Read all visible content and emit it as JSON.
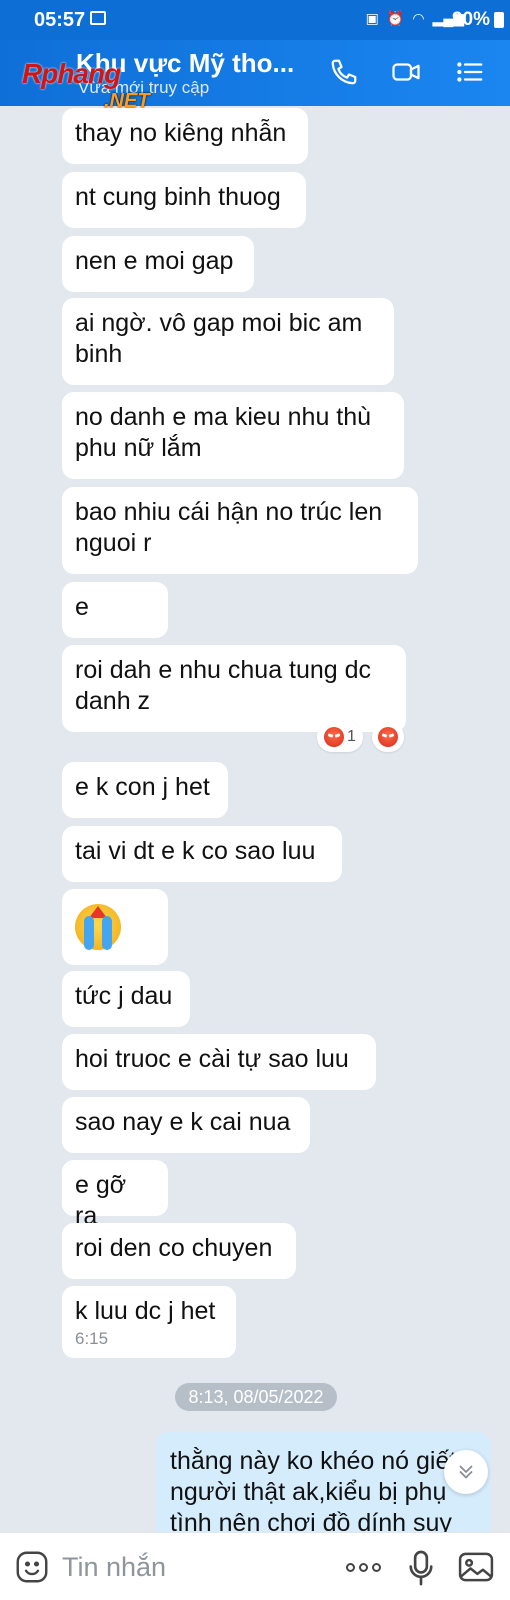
{
  "status_bar": {
    "time": "05:57",
    "battery": "90%"
  },
  "header": {
    "title": "Khu vực Mỹ tho...",
    "subtitle": "Vừa mới truy cập",
    "watermark": "Rphang",
    "watermark_net": ".NET"
  },
  "messages": [
    {
      "text": "thay no kiêng nhẫn"
    },
    {
      "text": "nt cung binh thuog"
    },
    {
      "text": "nen e moi gap"
    },
    {
      "text": "ai ngờ. vô gap moi bic am binh"
    },
    {
      "text": "no danh e ma kieu nhu thù phu nữ lắm"
    },
    {
      "text": "bao nhiu cái hận no trúc len nguoi r"
    },
    {
      "text": "e"
    },
    {
      "text": "roi dah e nhu chua tung dc danh z"
    },
    {
      "text": "e k con j het"
    },
    {
      "text": "tai vi dt e k co sao luu"
    },
    {
      "text": "tức j dau"
    },
    {
      "text": "hoi truoc e cài tự sao luu"
    },
    {
      "text": "sao nay e k cai nua"
    },
    {
      "text": "e gỡ ra"
    },
    {
      "text": "roi den co chuyen"
    },
    {
      "text": "k luu dc j het",
      "time": "6:15"
    }
  ],
  "reactions": {
    "count": "1"
  },
  "date_separator": "8:13, 08/05/2022",
  "outgoing": {
    "text": "thằng này ko khéo nó giết người thật ak,kiểu bị phụ tình nên chơi đồ dính suy"
  },
  "input": {
    "placeholder": "Tin nhắn"
  },
  "colors": {
    "header": "#1479e3",
    "incoming_bubble": "#ffffff",
    "outgoing_bubble": "#d5ecfd",
    "background": "#e3e8ef"
  }
}
